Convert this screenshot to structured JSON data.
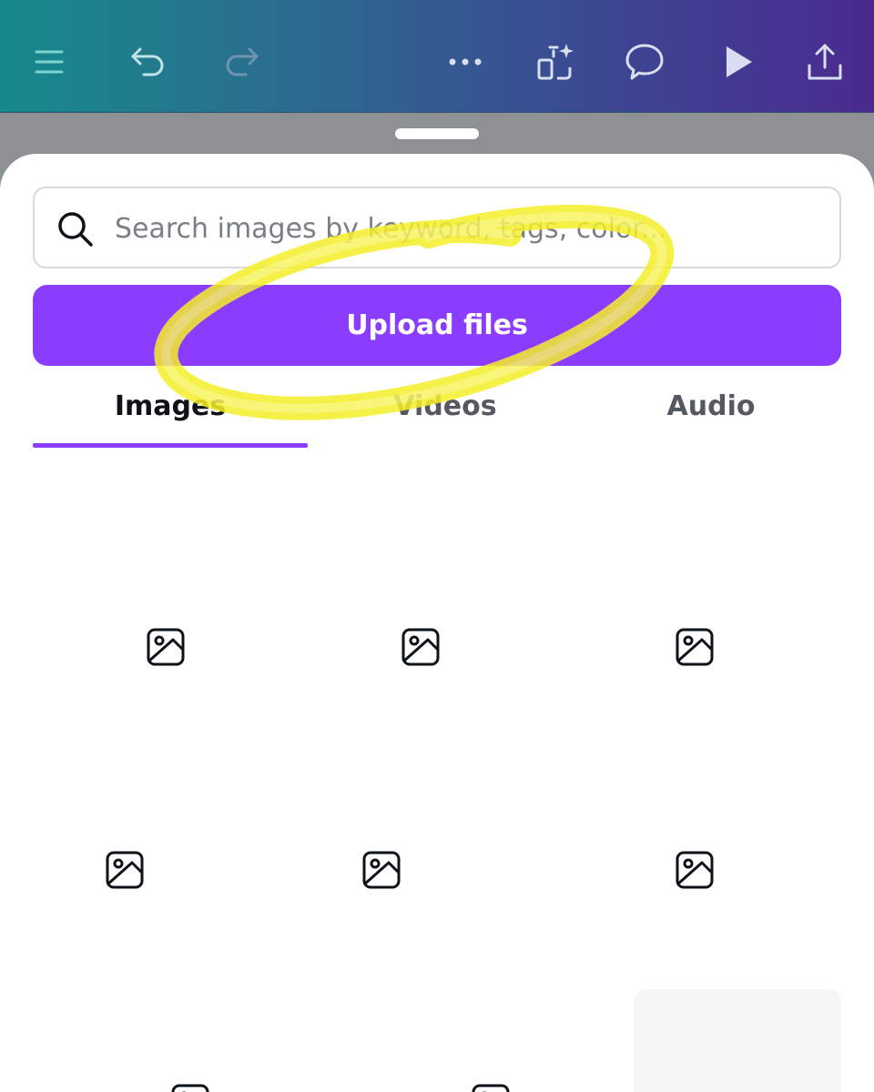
{
  "toolbar": {
    "items": [
      {
        "name": "menu-icon"
      },
      {
        "name": "undo-icon"
      },
      {
        "name": "redo-icon"
      },
      {
        "name": "more-icon"
      },
      {
        "name": "magic-switch-icon"
      },
      {
        "name": "comment-icon"
      },
      {
        "name": "present-play-icon"
      },
      {
        "name": "share-upload-icon"
      }
    ]
  },
  "search": {
    "placeholder": "Search images by keyword, tags, color..."
  },
  "upload": {
    "label": "Upload files"
  },
  "tabs": [
    {
      "label": "Images",
      "active": true
    },
    {
      "label": "Videos",
      "active": false
    },
    {
      "label": "Audio",
      "active": false
    }
  ],
  "grid": {
    "thumbnail_icon": "image-placeholder-icon",
    "count_visible_rows": 3
  },
  "colors": {
    "accent": "#8b3dff",
    "highlight_scribble": "#f5ef2a",
    "header_gradient_start": "#168a8c",
    "header_gradient_end": "#4b2a90"
  }
}
